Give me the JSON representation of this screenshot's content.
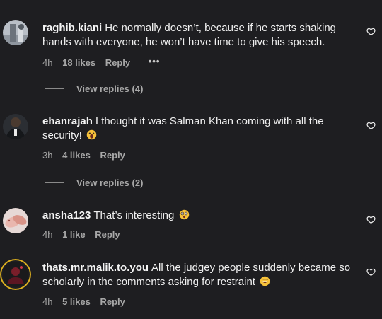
{
  "comments": [
    {
      "username": "raghib.kiani",
      "text": "He normally doesn’t, because if he starts shaking hands with everyone, he won’t have time to give his speech.",
      "time": "4h",
      "likes": "18 likes",
      "reply": "Reply",
      "more": "•••",
      "emoji": null,
      "view_replies": "View replies (4)"
    },
    {
      "username": "ehanrajah",
      "text": "I thought it was Salman Khan coming with all the security!",
      "time": "3h",
      "likes": "4 likes",
      "reply": "Reply",
      "emoji": "face-screaming-emoji",
      "view_replies": "View replies (2)"
    },
    {
      "username": "ansha123",
      "text": "That’s interesting",
      "time": "4h",
      "likes": "1 like",
      "reply": "Reply",
      "emoji": "dizzy-face-emoji"
    },
    {
      "username": "thats.mr.malik.to.you",
      "text": "All the judgey people suddenly became so scholarly in the comments asking for restraint",
      "time": "4h",
      "likes": "5 likes",
      "reply": "Reply",
      "emoji": "grinning-face-emoji"
    }
  ],
  "colors": {
    "background": "#1e1e21",
    "text": "#f0f0f0",
    "muted": "#a8a8a8",
    "emoji": "#f7c23a",
    "story_ring": "#e0b21f"
  }
}
